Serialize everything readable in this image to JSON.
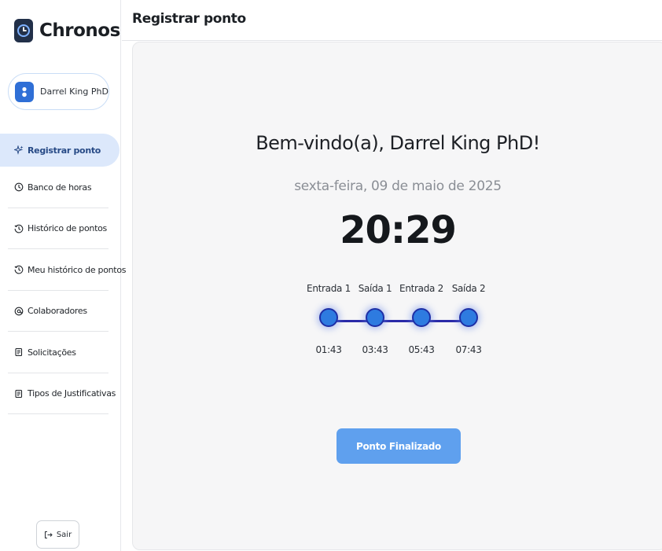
{
  "app": {
    "name": "Chronos",
    "accent": "#2f6fd6"
  },
  "user": {
    "name": "Darrel King PhD"
  },
  "sidebar": {
    "items": [
      {
        "label": "Registrar ponto",
        "icon": "sparkle-icon",
        "active": true
      },
      {
        "label": "Banco de horas",
        "icon": "clock-icon",
        "active": false
      },
      {
        "label": "Histórico de pontos",
        "icon": "history-icon",
        "active": false
      },
      {
        "label": "Meu histórico de pontos",
        "icon": "history-icon",
        "active": false
      },
      {
        "label": "Colaboradores",
        "icon": "at-icon",
        "active": false
      },
      {
        "label": "Solicitações",
        "icon": "clipboard-icon",
        "active": false
      },
      {
        "label": "Tipos de Justificativas",
        "icon": "clipboard-icon",
        "active": false
      }
    ],
    "logout_label": "Sair"
  },
  "header": {
    "title": "Registrar ponto"
  },
  "main": {
    "welcome": "Bem-vindo(a), Darrel King PhD!",
    "date": "sexta-feira, 09 de maio de 2025",
    "clock": "20:29",
    "timeline": [
      {
        "label": "Entrada 1",
        "time": "01:43"
      },
      {
        "label": "Saída 1",
        "time": "03:43"
      },
      {
        "label": "Entrada 2",
        "time": "05:43"
      },
      {
        "label": "Saída 2",
        "time": "07:43"
      }
    ],
    "button_label": "Ponto Finalizado"
  }
}
